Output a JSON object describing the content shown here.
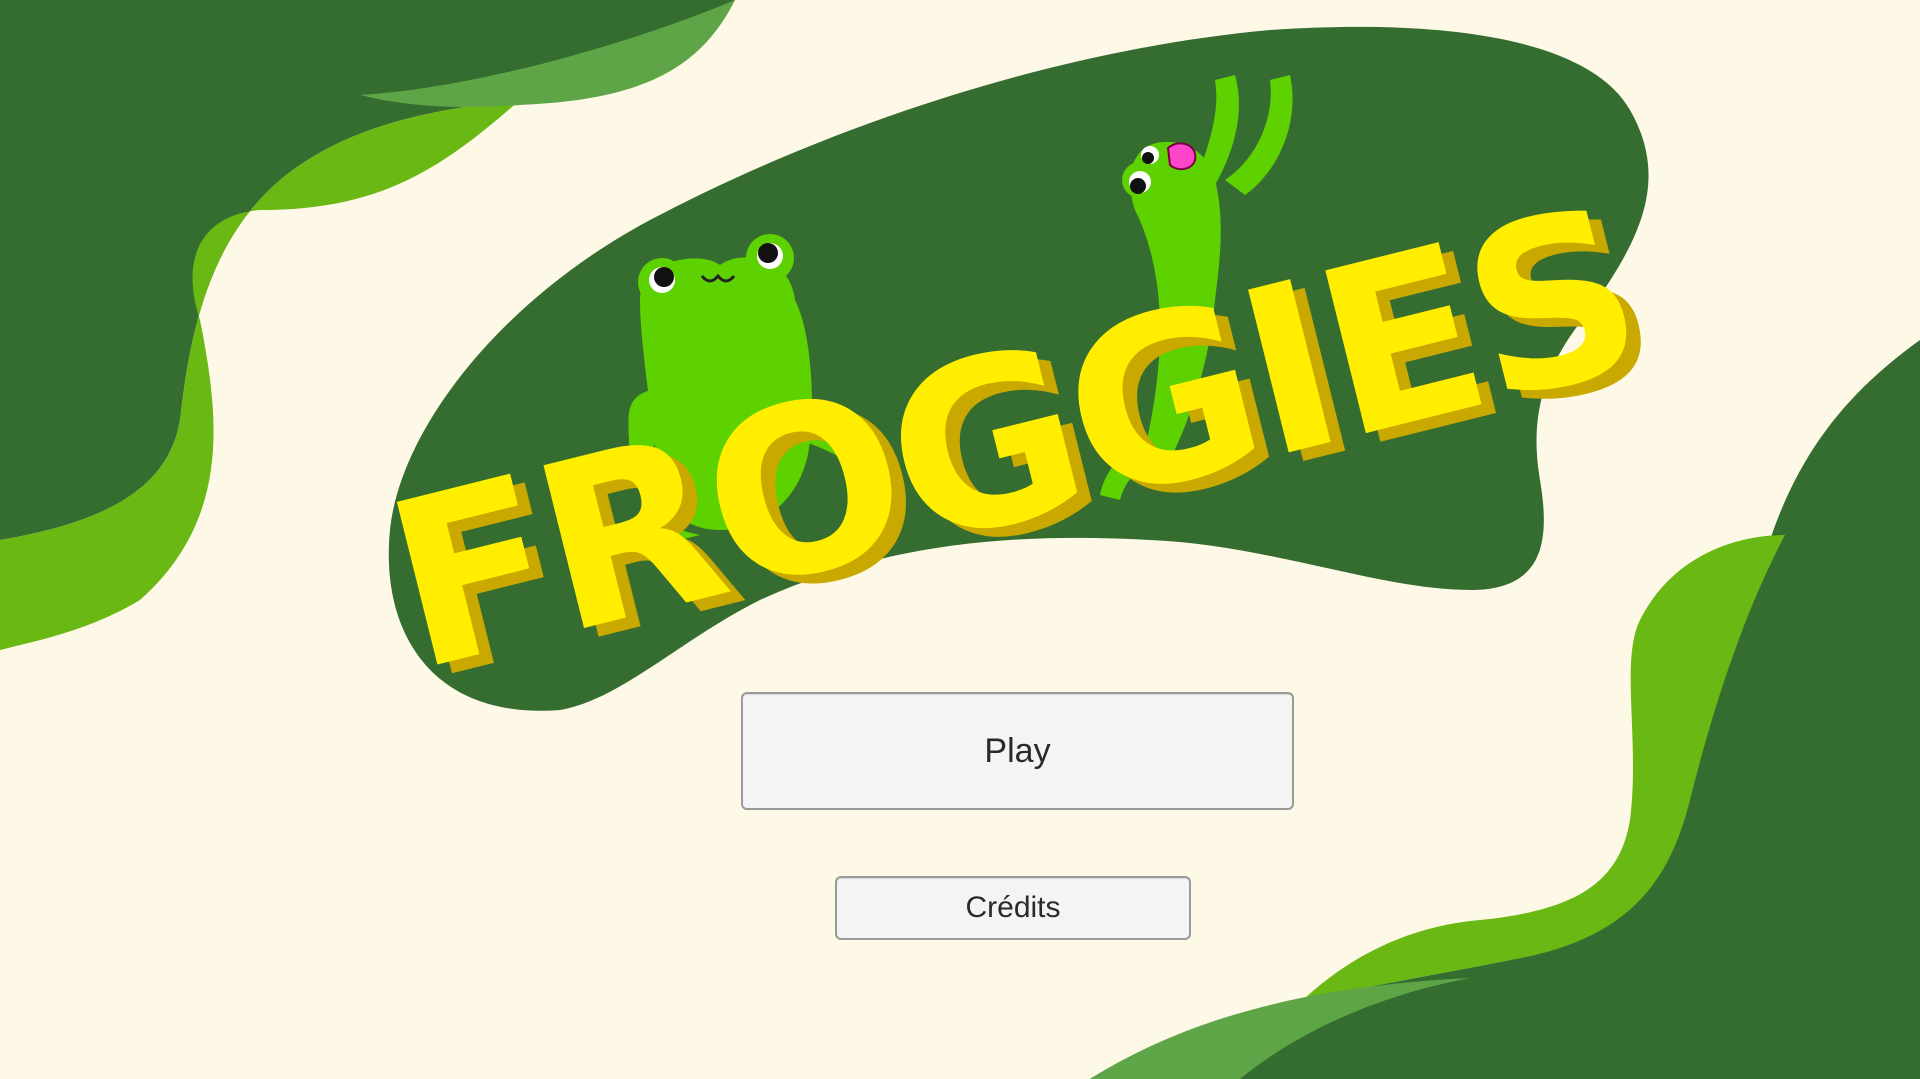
{
  "game": {
    "title": "FROGGIES"
  },
  "menu": {
    "play_label": "Play",
    "credits_label": "Crédits"
  },
  "colors": {
    "background": "#fdf9e6",
    "dark_green": "#356d31",
    "lime_green": "#6ab814",
    "mid_green": "#5ea547",
    "title_yellow": "#ffee00",
    "title_shadow": "#c9a800",
    "frog_green": "#5ed100",
    "frog_tongue": "#ff45c8"
  }
}
